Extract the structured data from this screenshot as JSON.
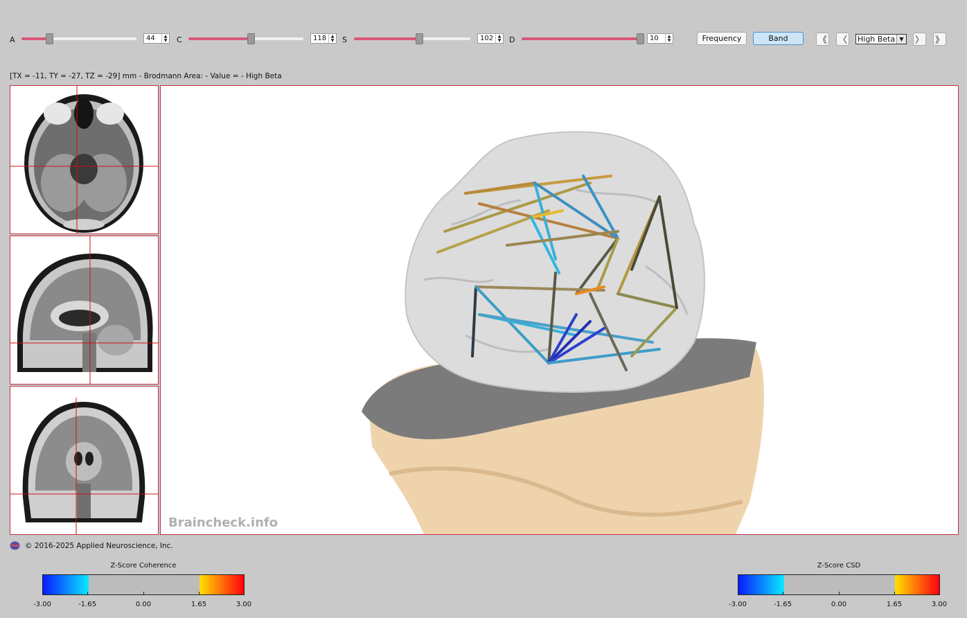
{
  "controls": {
    "sliders": [
      {
        "label": "A",
        "value": "44",
        "fraction": 0.24
      },
      {
        "label": "C",
        "value": "118",
        "fraction": 0.54
      },
      {
        "label": "S",
        "value": "102",
        "fraction": 0.55
      },
      {
        "label": "D",
        "value": "10",
        "fraction": 1.0
      }
    ],
    "mode_buttons": [
      {
        "label": "Frequency",
        "active": false
      },
      {
        "label": "Band",
        "active": true
      }
    ],
    "nav": {
      "first": "《",
      "prev": "〈",
      "next": "〉",
      "last": "》"
    },
    "band_select": {
      "value": "High Beta"
    }
  },
  "status_line": "[TX = -11, TY = -27, TZ = -29] mm - Brodmann Area:  - Value =  - High Beta",
  "watermark": "Braincheck.info",
  "copyright": "© 2016-2025 Applied Neuroscience, Inc.",
  "colorbars": [
    {
      "title": "Z-Score Coherence",
      "ticks": [
        "-3.00",
        "-1.65",
        "0.00",
        "1.65",
        "3.00"
      ]
    },
    {
      "title": "Z-Score CSD",
      "ticks": [
        "-3.00",
        "-1.65",
        "0.00",
        "1.65",
        "3.00"
      ]
    }
  ],
  "colors": {
    "accent": "#d9577a",
    "panel_border": "#c03040",
    "crosshair": "#d01010",
    "skin": "#efd3ad",
    "cortex": "#dcdcdc"
  }
}
